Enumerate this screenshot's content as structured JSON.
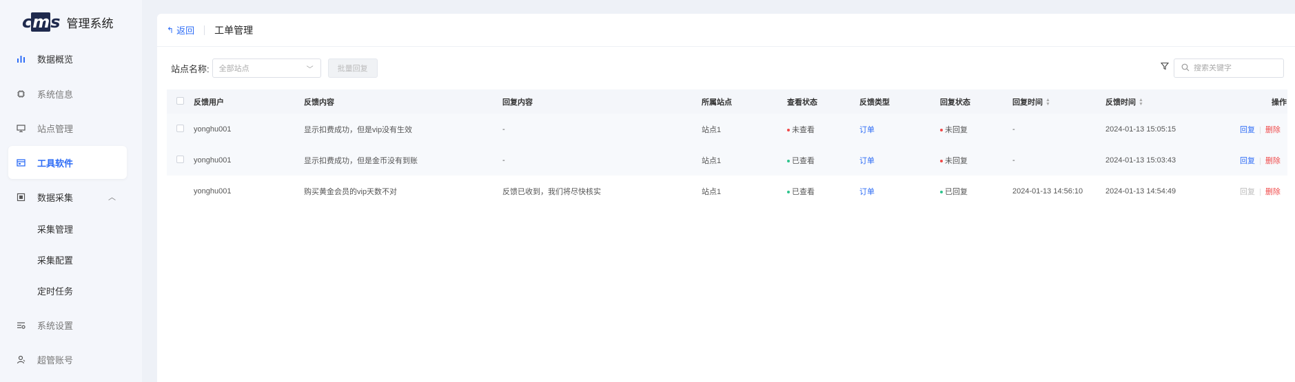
{
  "app": {
    "logo_mark_a": "c",
    "logo_mark_m": "m",
    "logo_mark_s": "s",
    "title": "管理系统"
  },
  "sidebar": {
    "items": [
      {
        "label": "数据概览",
        "icon": "bar-chart-icon"
      },
      {
        "label": "系统信息",
        "icon": "chip-icon"
      },
      {
        "label": "站点管理",
        "icon": "monitor-icon"
      },
      {
        "label": "工具软件",
        "icon": "window-icon"
      },
      {
        "label": "数据采集",
        "icon": "database-icon"
      },
      {
        "label": "系统设置",
        "icon": "settings-icon"
      },
      {
        "label": "超管账号",
        "icon": "user-icon"
      }
    ],
    "sub_items": [
      "采集管理",
      "采集配置",
      "定时任务"
    ]
  },
  "header": {
    "back_label": "返回",
    "page_title": "工单管理"
  },
  "filters": {
    "site_label": "站点名称:",
    "site_select_value": "全部站点",
    "batch_reply_label": "批量回复",
    "search_placeholder": "搜索关键字"
  },
  "table": {
    "columns": {
      "user": "反馈用户",
      "content": "反馈内容",
      "reply": "回复内容",
      "site": "所属站点",
      "view_status": "查看状态",
      "type": "反馈类型",
      "reply_status": "回复状态",
      "reply_time": "回复时间",
      "feedback_time": "反馈时间",
      "actions": "操作"
    },
    "action_reply": "回复",
    "action_delete": "删除",
    "rows": [
      {
        "user": "yonghu001",
        "content": "显示扣费成功，但是vip没有生效",
        "reply": "-",
        "site": "站点1",
        "view_status": "未查看",
        "view_color": "#f04a4a",
        "type": "订单",
        "reply_status": "未回复",
        "reply_color": "#f04a4a",
        "reply_time": "-",
        "feedback_time": "2024-01-13 15:05:15"
      },
      {
        "user": "yonghu001",
        "content": "显示扣费成功，但是金币没有到账",
        "reply": "-",
        "site": "站点1",
        "view_status": "已查看",
        "view_color": "#2fc48d",
        "type": "订单",
        "reply_status": "未回复",
        "reply_color": "#f04a4a",
        "reply_time": "-",
        "feedback_time": "2024-01-13 15:03:43"
      },
      {
        "user": "yonghu001",
        "content": "购买黄金会员的vip天数不对",
        "reply": "反馈已收到，我们将尽快核实",
        "site": "站点1",
        "view_status": "已查看",
        "view_color": "#2fc48d",
        "type": "订单",
        "reply_status": "已回复",
        "reply_color": "#2fc48d",
        "reply_time": "2024-01-13 14:56:10",
        "feedback_time": "2024-01-13 14:54:49"
      }
    ]
  },
  "colors": {
    "accent": "#2d6cf6",
    "danger": "#f04a4a",
    "success": "#2fc48d"
  }
}
